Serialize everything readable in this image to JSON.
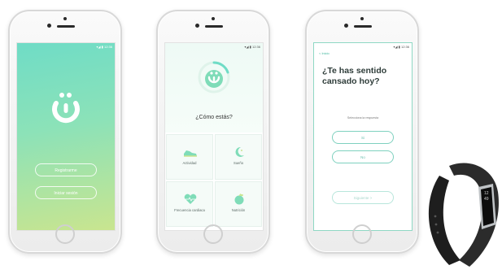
{
  "status_bar": {
    "text": "▾◢ ▮ 12:36"
  },
  "screen1": {
    "buttons": [
      {
        "label": "Registrarme"
      },
      {
        "label": "Iniciar sesión"
      }
    ],
    "gradient_start": "#6fdcc6",
    "gradient_end": "#c9e58f"
  },
  "screen2": {
    "question": "¿Cómo estás?",
    "tiles": [
      {
        "label": "Actividad",
        "icon": "shoe-icon"
      },
      {
        "label": "Sueño",
        "icon": "moon-icon"
      },
      {
        "label": "Frecuencia cardiaca",
        "icon": "heart-icon"
      },
      {
        "label": "Nutrición",
        "icon": "apple-icon"
      }
    ]
  },
  "screen3": {
    "back_label": "< Inicio",
    "question": "¿Te has sentido cansado hoy?",
    "hint": "Selecciona la respuesta",
    "answers": [
      {
        "label": "Si"
      },
      {
        "label": "No"
      }
    ],
    "next_label": "Siguiente >"
  },
  "tracker": {
    "time_top": "12",
    "time_bottom": "49"
  },
  "colors": {
    "accent": "#41b89e",
    "teal": "#6fdcc6",
    "lime": "#c9e58f"
  }
}
